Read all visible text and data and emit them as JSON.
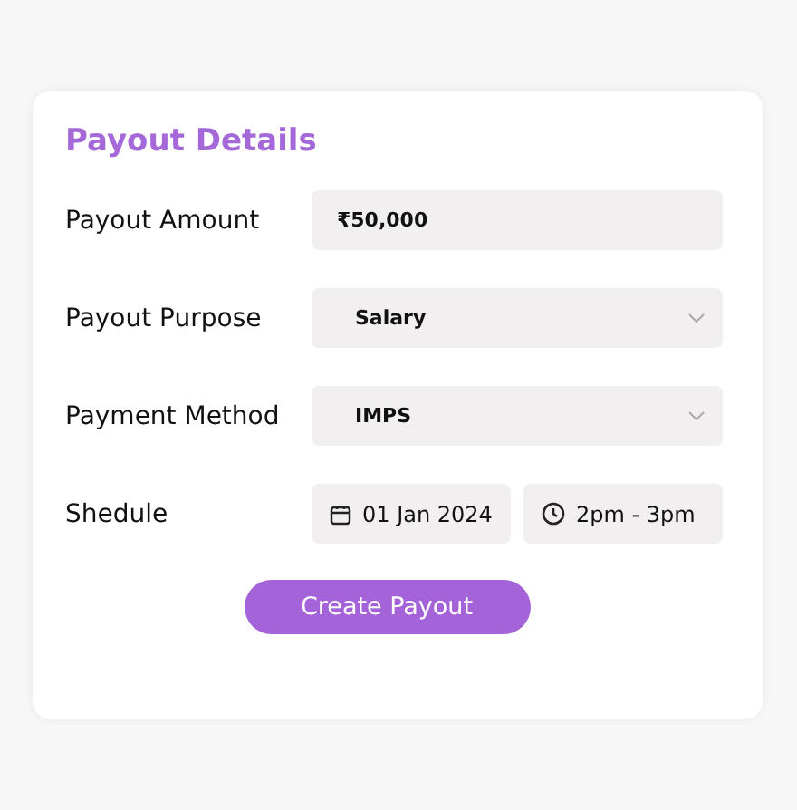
{
  "card": {
    "title": "Payout Details",
    "fields": [
      {
        "kind": "text",
        "label": "Payout Amount",
        "value": "₹50,000"
      },
      {
        "kind": "select",
        "label": "Payout Purpose",
        "value": "Salary"
      },
      {
        "kind": "select",
        "label": "Payment Method",
        "value": "IMPS"
      },
      {
        "kind": "schedule",
        "label": "Shedule",
        "date": "01 Jan 2024",
        "time": "2pm - 3pm"
      }
    ],
    "button": "Create Payout"
  }
}
